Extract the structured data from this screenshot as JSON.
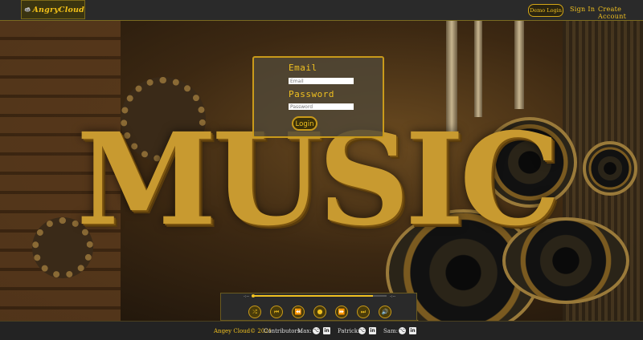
{
  "navbar": {
    "logo_text": "AngryCloud",
    "demo_login": "Demo Login",
    "sign_in": "Sign In",
    "create_account": "Create Account"
  },
  "hero": {
    "background_word": "MUSIC"
  },
  "login": {
    "email_label": "Email",
    "email_placeholder": "Email",
    "email_value": "",
    "password_label": "Password",
    "password_placeholder": "Password",
    "password_value": "",
    "button_label": "Login"
  },
  "player": {
    "current_time": "-:--",
    "duration": "-:--",
    "progress": 0.9,
    "controls": [
      {
        "name": "shuffle-icon",
        "glyph": "⤮"
      },
      {
        "name": "skip-previous-icon",
        "glyph": "⏮"
      },
      {
        "name": "rewind-icon",
        "glyph": "⏪"
      },
      {
        "name": "play-icon",
        "glyph": "●"
      },
      {
        "name": "fast-forward-icon",
        "glyph": "⏩"
      },
      {
        "name": "skip-next-icon",
        "glyph": "⏭"
      },
      {
        "name": "volume-icon",
        "glyph": "🔊"
      }
    ]
  },
  "footer": {
    "brand": "Angey Cloud© 2021",
    "contributors_label": "Contributors:",
    "contributors": [
      {
        "name": "Max:"
      },
      {
        "name": "Patrick:"
      },
      {
        "name": "Sam:"
      }
    ]
  },
  "colors": {
    "accent": "#f0c020",
    "border_gold": "#c99a1a",
    "navbar_bg": "#2a2a2a",
    "footer_bg": "#232323"
  }
}
